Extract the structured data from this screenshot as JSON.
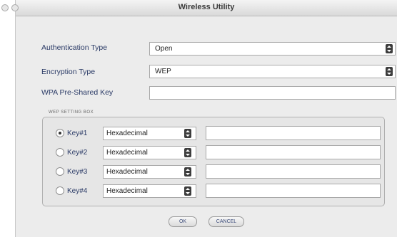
{
  "window": {
    "title": "Wireless Utility"
  },
  "form": {
    "auth_label": "Authentication Type",
    "auth_value": "Open",
    "enc_label": "Encryption Type",
    "enc_value": "WEP",
    "wpa_label": "WPA Pre-Shared Key",
    "wpa_value": ""
  },
  "wep": {
    "section_title": "WEP SETTING BOX",
    "keys": [
      {
        "label": "Key#1",
        "format": "Hexadecimal",
        "value": "",
        "selected": true
      },
      {
        "label": "Key#2",
        "format": "Hexadecimal",
        "value": "",
        "selected": false
      },
      {
        "label": "Key#3",
        "format": "Hexadecimal",
        "value": "",
        "selected": false
      },
      {
        "label": "Key#4",
        "format": "Hexadecimal",
        "value": "",
        "selected": false
      }
    ]
  },
  "buttons": {
    "ok": "OK",
    "cancel": "CANCEL"
  }
}
